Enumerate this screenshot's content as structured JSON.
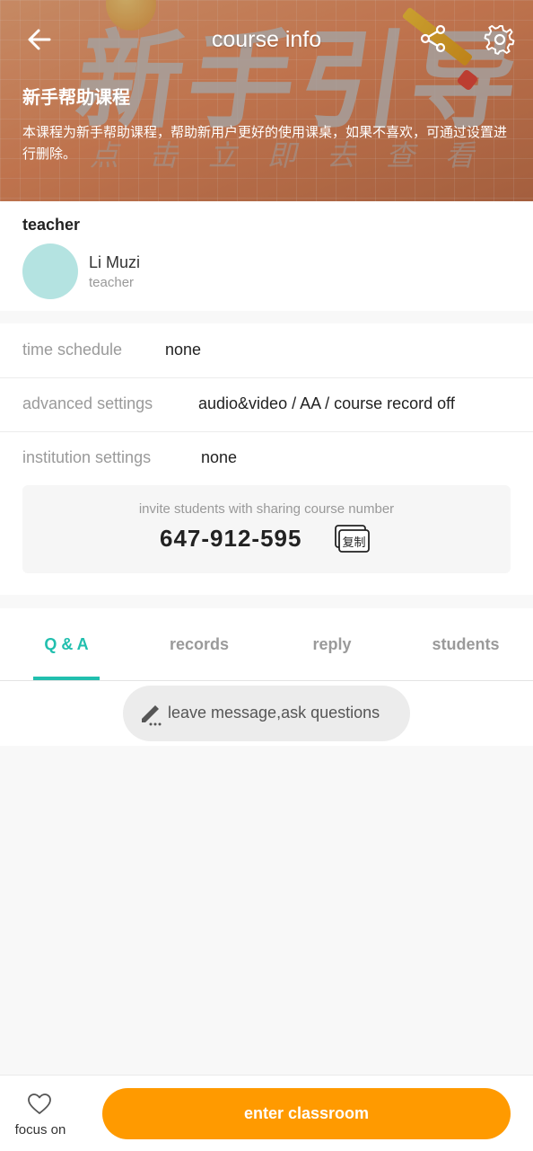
{
  "header": {
    "title": "course info",
    "banner_art_text": "新手引导",
    "banner_art_subtext": "点击立即去查看"
  },
  "course": {
    "name": "新手帮助课程",
    "description": "本课程为新手帮助课程，帮助新用户更好的使用课桌，如果不喜欢，可通过设置进行删除。"
  },
  "teacher": {
    "section_label": "teacher",
    "name": "Li Muzi",
    "role": "teacher"
  },
  "settings": [
    {
      "label": "time schedule",
      "value": "none"
    },
    {
      "label": "advanced settings",
      "value": "audio&video  / AA / course record off"
    },
    {
      "label": "institution settings",
      "value": "none"
    }
  ],
  "invite": {
    "hint": "invite students with sharing course number",
    "course_number": "647-912-595",
    "copy_label": "复制"
  },
  "tabs": [
    {
      "label": "Q & A",
      "active": true
    },
    {
      "label": "records",
      "active": false
    },
    {
      "label": "reply",
      "active": false
    },
    {
      "label": "students",
      "active": false
    }
  ],
  "message_button": "leave message,ask questions",
  "bottom": {
    "focus_label": "focus on",
    "enter_label": "enter classroom"
  },
  "colors": {
    "accent": "#21bfae",
    "primary_button": "#ff9a00",
    "avatar": "#b4e3e1"
  }
}
